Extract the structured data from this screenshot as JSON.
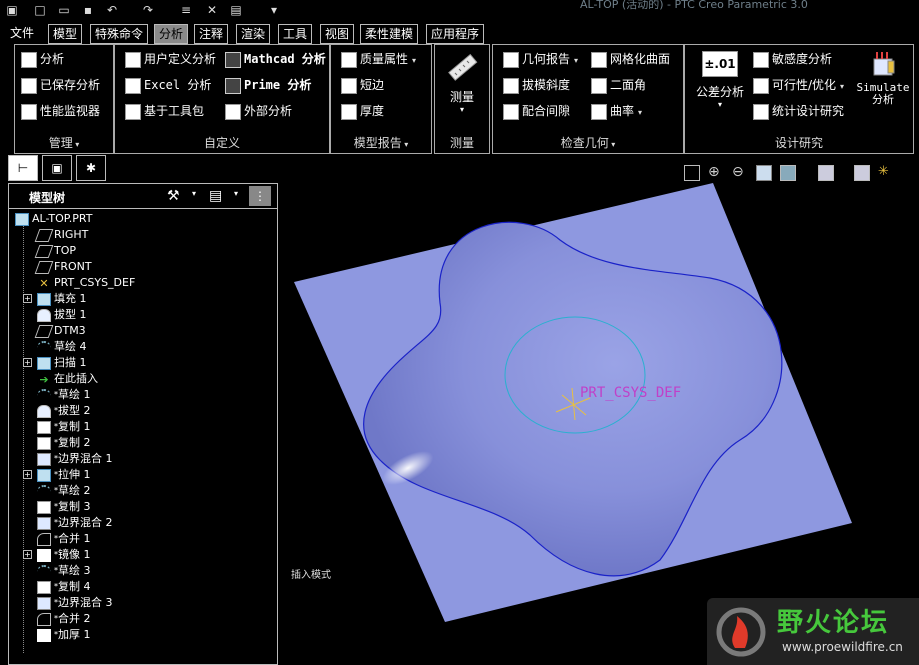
{
  "window": {
    "title": "AL-TOP (活动的) - PTC Creo Parametric 3.0"
  },
  "menu_tabs": [
    {
      "label": "文件"
    },
    {
      "label": "模型"
    },
    {
      "label": "特殊命令"
    },
    {
      "label": "分析"
    },
    {
      "label": "注释"
    },
    {
      "label": "渲染"
    },
    {
      "label": "工具"
    },
    {
      "label": "视图"
    },
    {
      "label": "柔性建模"
    },
    {
      "label": "应用程序"
    }
  ],
  "ribbon": {
    "manage": {
      "label": "管理",
      "items": [
        "分析",
        "已保存分析",
        "性能监视器"
      ]
    },
    "custom": {
      "label": "自定义",
      "items": [
        "用户定义分析",
        "Mathcad 分析",
        "Excel 分析",
        "Prime 分析",
        "基于工具包",
        "外部分析"
      ]
    },
    "model_report": {
      "label": "模型报告",
      "items": [
        "质量属性",
        "短边",
        "厚度"
      ]
    },
    "measure": {
      "label": "测量",
      "button": "测量"
    },
    "inspect_geometry": {
      "label": "检查几何",
      "items": [
        "几何报告",
        "网格化曲面",
        "拔模斜度",
        "二面角",
        "配合间隙",
        "曲率"
      ]
    },
    "design_study": {
      "label": "设计研究",
      "tolerance_label": "公差分析",
      "tolerance_icon_text": "±.01",
      "items": [
        "敏感度分析",
        "可行性/优化",
        "统计设计研究"
      ],
      "simulate_line1": "Simulate",
      "simulate_line2": "分析"
    }
  },
  "model_tree": {
    "header": "模型树",
    "nodes": [
      {
        "label": "AL-TOP.PRT",
        "icon": "part-icon"
      },
      {
        "label": "RIGHT",
        "icon": "datum-plane-icon"
      },
      {
        "label": "TOP",
        "icon": "datum-plane-icon"
      },
      {
        "label": "FRONT",
        "icon": "datum-plane-icon"
      },
      {
        "label": "PRT_CSYS_DEF",
        "icon": "csys-icon"
      },
      {
        "label": "填充 1",
        "icon": "fill-icon"
      },
      {
        "label": "拔型 1",
        "icon": "surface-icon"
      },
      {
        "label": "DTM3",
        "icon": "datum-plane-icon"
      },
      {
        "label": "草绘 4",
        "icon": "sketch-icon"
      },
      {
        "label": "扫描 1",
        "icon": "sweep-icon"
      },
      {
        "label": "在此插入",
        "icon": "insert-arrow-icon"
      },
      {
        "label": "草绘 1",
        "icon": "sketch-icon"
      },
      {
        "label": "拔型 2",
        "icon": "surface-icon"
      },
      {
        "label": "复制 1",
        "icon": "copy-icon"
      },
      {
        "label": "复制 2",
        "icon": "copy-icon"
      },
      {
        "label": "边界混合 1",
        "icon": "boundary-blend-icon"
      },
      {
        "label": "拉伸 1",
        "icon": "extrude-icon"
      },
      {
        "label": "草绘 2",
        "icon": "sketch-icon"
      },
      {
        "label": "复制 3",
        "icon": "copy-icon"
      },
      {
        "label": "边界混合 2",
        "icon": "boundary-blend-icon"
      },
      {
        "label": "合并 1",
        "icon": "merge-icon"
      },
      {
        "label": "镜像 1",
        "icon": "mirror-icon"
      },
      {
        "label": "草绘 3",
        "icon": "sketch-icon"
      },
      {
        "label": "复制 4",
        "icon": "copy-icon"
      },
      {
        "label": "边界混合 3",
        "icon": "boundary-blend-icon"
      },
      {
        "label": "合并 2",
        "icon": "merge-icon"
      },
      {
        "label": "加厚 1",
        "icon": "thicken-icon"
      }
    ]
  },
  "viewport": {
    "csys_label": "PRT_CSYS_DEF",
    "status_text": "插入模式",
    "surface_color": "#8e98e0",
    "outline_color": "#1a22c8",
    "inner_circle_color": "#2ab0d0"
  },
  "watermark": {
    "title": "野火论坛",
    "url": "www.proewildfire.cn"
  }
}
